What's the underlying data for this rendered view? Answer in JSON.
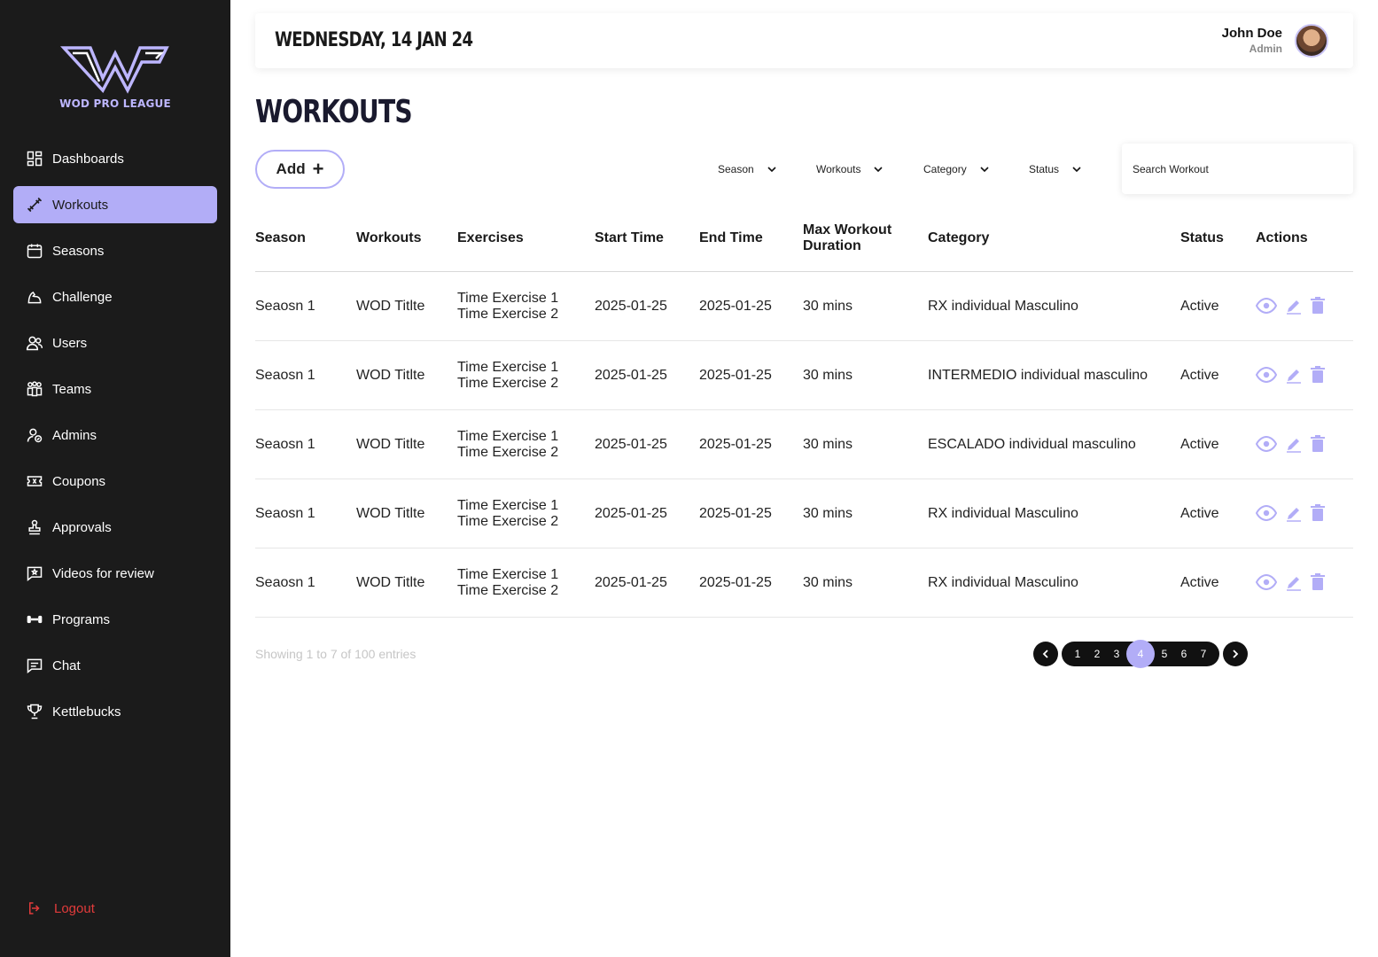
{
  "brand": {
    "name": "WOD PRO LEAGUE"
  },
  "sidebar": {
    "items": [
      {
        "label": "Dashboards",
        "icon": "dashboard-icon"
      },
      {
        "label": "Workouts",
        "icon": "dumbbell-icon",
        "active": true
      },
      {
        "label": "Seasons",
        "icon": "calendar-icon"
      },
      {
        "label": "Challenge",
        "icon": "flex-arm-icon"
      },
      {
        "label": "Users",
        "icon": "users-icon"
      },
      {
        "label": "Teams",
        "icon": "teams-icon"
      },
      {
        "label": "Admins",
        "icon": "admin-icon"
      },
      {
        "label": "Coupons",
        "icon": "ticket-icon"
      },
      {
        "label": "Approvals",
        "icon": "stamp-icon"
      },
      {
        "label": "Videos for review",
        "icon": "video-review-icon"
      },
      {
        "label": "Programs",
        "icon": "weights-icon"
      },
      {
        "label": "Chat",
        "icon": "chat-icon"
      },
      {
        "label": "Kettlebucks",
        "icon": "trophy-icon"
      }
    ],
    "logout": "Logout"
  },
  "header": {
    "date": "WEDNESDAY, 14 JAN 24",
    "user_name": "John Doe",
    "user_role": "Admin"
  },
  "main": {
    "title": "WORKOUTS",
    "add_label": "Add",
    "filters": [
      "Season",
      "Workouts",
      "Category",
      "Status"
    ],
    "search_placeholder": "Search Workout",
    "columns": [
      "Season",
      "Workouts",
      "Exercises",
      "Start Time",
      "End Time",
      "Max Workout Duration",
      "Category",
      "Status",
      "Actions"
    ],
    "rows": [
      {
        "season": "Seaosn 1",
        "workout": "WOD Titlte",
        "ex1": "Time Exercise 1",
        "ex2": "Time Exercise 2",
        "start": "2025-01-25",
        "end": "2025-01-25",
        "duration": "30 mins",
        "category": "RX individual Masculino",
        "status": "Active"
      },
      {
        "season": "Seaosn 1",
        "workout": "WOD Titlte",
        "ex1": "Time Exercise 1",
        "ex2": "Time Exercise 2",
        "start": "2025-01-25",
        "end": "2025-01-25",
        "duration": "30 mins",
        "category": "INTERMEDIO individual masculino",
        "status": "Active"
      },
      {
        "season": "Seaosn 1",
        "workout": "WOD Titlte",
        "ex1": "Time Exercise 1",
        "ex2": "Time Exercise 2",
        "start": "2025-01-25",
        "end": "2025-01-25",
        "duration": "30 mins",
        "category": "ESCALADO individual masculino",
        "status": "Active"
      },
      {
        "season": "Seaosn 1",
        "workout": "WOD Titlte",
        "ex1": "Time Exercise 1",
        "ex2": "Time Exercise 2",
        "start": "2025-01-25",
        "end": "2025-01-25",
        "duration": "30 mins",
        "category": "RX individual Masculino",
        "status": "Active"
      },
      {
        "season": "Seaosn 1",
        "workout": "WOD Titlte",
        "ex1": "Time Exercise 1",
        "ex2": "Time Exercise 2",
        "start": "2025-01-25",
        "end": "2025-01-25",
        "duration": "30 mins",
        "category": "RX individual Masculino",
        "status": "Active"
      }
    ],
    "showing": "Showing 1 to 7 of 100 entries",
    "pages": [
      "1",
      "2",
      "3",
      "4",
      "5",
      "6",
      "7"
    ],
    "current_page": "4"
  },
  "colors": {
    "sidebar_bg": "#1b1b1b",
    "accent": "#b2adf7",
    "logout": "#e23b3b"
  }
}
